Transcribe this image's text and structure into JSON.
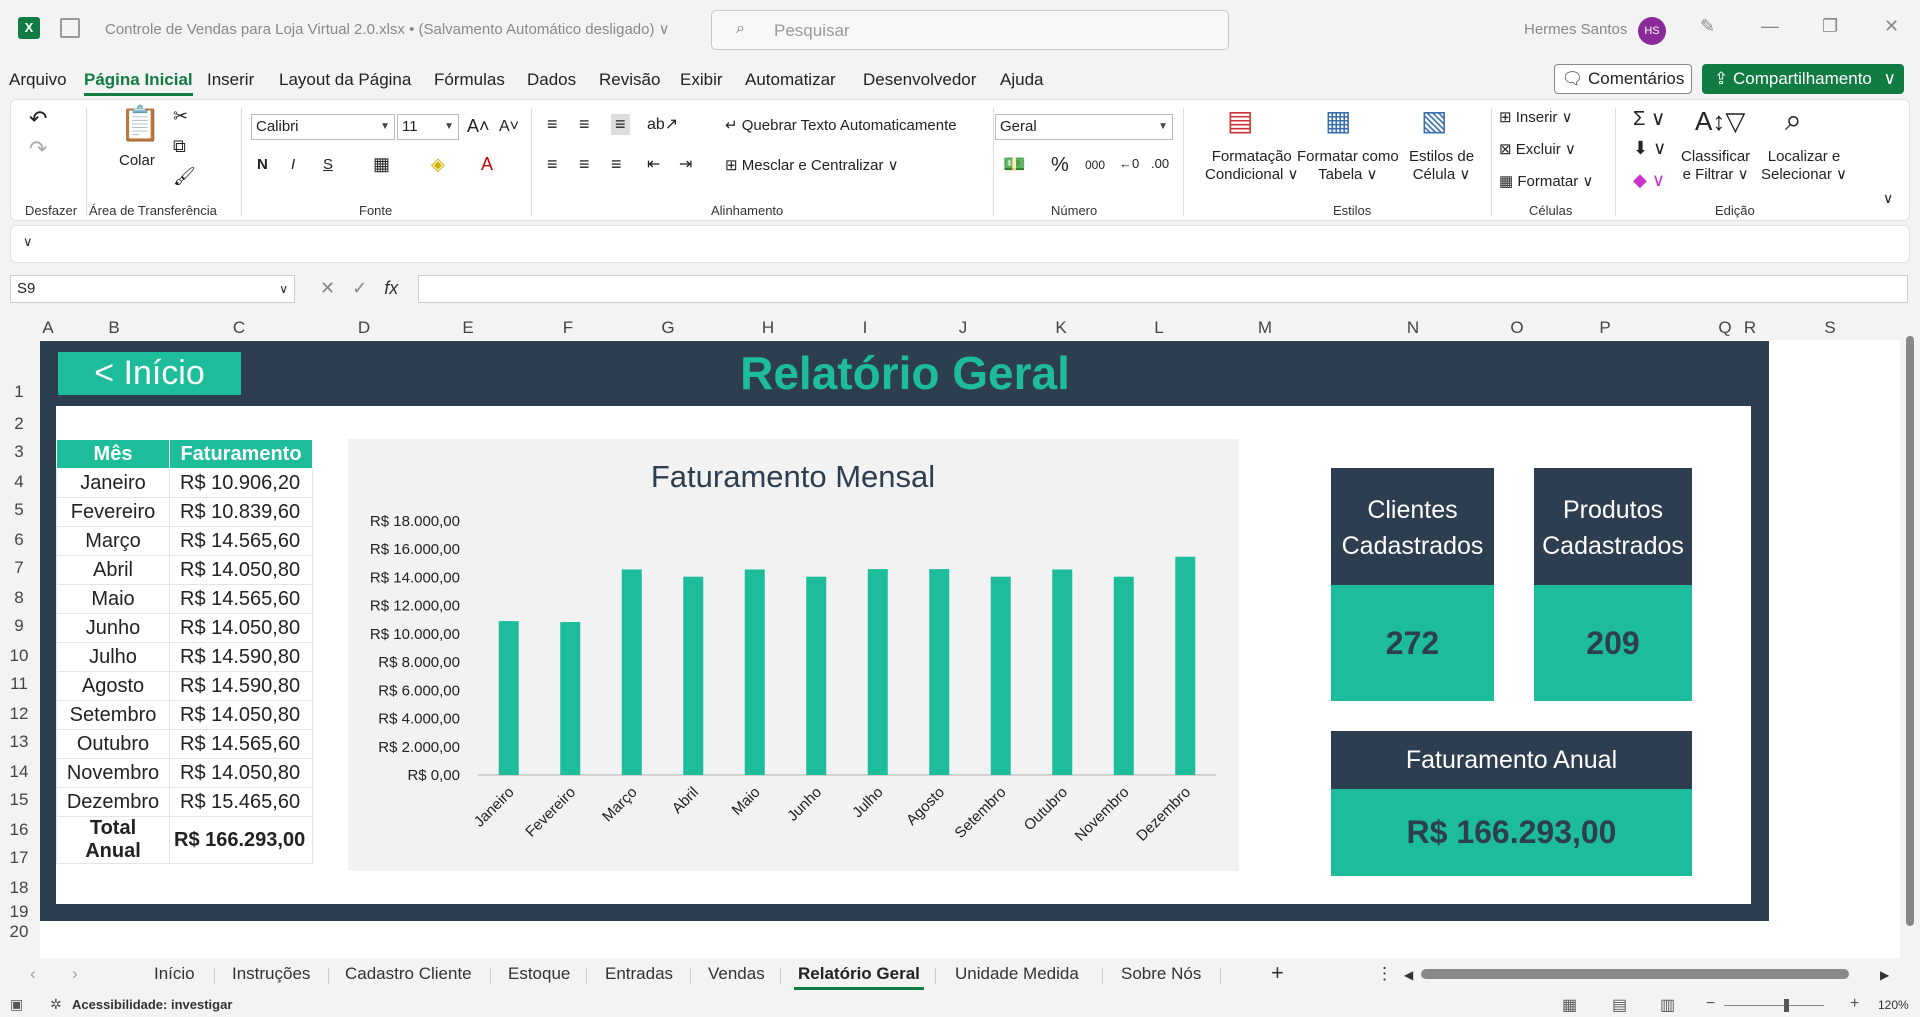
{
  "titlebar": {
    "doc_title": "Controle de Vendas para Loja Virtual 2.0.xlsx  •  (Salvamento Automático desligado) ∨",
    "search_placeholder": "Pesquisar",
    "user_name": "Hermes Santos",
    "user_initials": "HS"
  },
  "menu": {
    "items": [
      "Arquivo",
      "Página Inicial",
      "Inserir",
      "Layout da Página",
      "Fórmulas",
      "Dados",
      "Revisão",
      "Exibir",
      "Automatizar",
      "Desenvolvedor",
      "Ajuda"
    ],
    "active_index": 1,
    "comments_label": "Comentários",
    "share_label": "Compartilhamento"
  },
  "ribbon": {
    "groups": {
      "undo": "Desfazer",
      "clipboard": "Área de Transferência",
      "font": "Fonte",
      "alignment": "Alinhamento",
      "number": "Número",
      "styles": "Estilos",
      "cells": "Células",
      "editing": "Edição"
    },
    "paste_label": "Colar",
    "font_name": "Calibri",
    "font_size": "11",
    "bold": "N",
    "italic": "I",
    "underline": "S",
    "wrap_text": "Quebrar Texto Automaticamente",
    "merge_center": "Mesclar e Centralizar",
    "number_format": "Geral",
    "cond_format_1": "Formatação",
    "cond_format_2": "Condicional ∨",
    "format_table_1": "Formatar como",
    "format_table_2": "Tabela ∨",
    "cell_styles_1": "Estilos de",
    "cell_styles_2": "Célula ∨",
    "insert": "Inserir",
    "delete": "Excluir",
    "format": "Formatar",
    "sort_filter_1": "Classificar",
    "sort_filter_2": "e Filtrar ∨",
    "find_select_1": "Localizar e",
    "find_select_2": "Selecionar ∨"
  },
  "formula_bar": {
    "name_box": "S9",
    "fx": "fx",
    "value": ""
  },
  "columns": [
    "A",
    "B",
    "C",
    "D",
    "E",
    "F",
    "G",
    "H",
    "I",
    "J",
    "K",
    "L",
    "M",
    "N",
    "O",
    "P",
    "Q",
    "R",
    "S"
  ],
  "rows": [
    "1",
    "2",
    "3",
    "4",
    "5",
    "6",
    "7",
    "8",
    "9",
    "10",
    "11",
    "12",
    "13",
    "14",
    "15",
    "16",
    "17",
    "18",
    "19",
    "20"
  ],
  "dashboard": {
    "back_button": "< Início",
    "title": "Relatório Geral",
    "table": {
      "header_month": "Mês",
      "header_revenue": "Faturamento",
      "rows": [
        {
          "month": "Janeiro",
          "value": "R$ 10.906,20"
        },
        {
          "month": "Fevereiro",
          "value": "R$ 10.839,60"
        },
        {
          "month": "Março",
          "value": "R$ 14.565,60"
        },
        {
          "month": "Abril",
          "value": "R$ 14.050,80"
        },
        {
          "month": "Maio",
          "value": "R$ 14.565,60"
        },
        {
          "month": "Junho",
          "value": "R$ 14.050,80"
        },
        {
          "month": "Julho",
          "value": "R$ 14.590,80"
        },
        {
          "month": "Agosto",
          "value": "R$ 14.590,80"
        },
        {
          "month": "Setembro",
          "value": "R$ 14.050,80"
        },
        {
          "month": "Outubro",
          "value": "R$ 14.565,60"
        },
        {
          "month": "Novembro",
          "value": "R$ 14.050,80"
        },
        {
          "month": "Dezembro",
          "value": "R$ 15.465,60"
        }
      ],
      "total_label": "Total Anual",
      "total_value": "R$ 166.293,00"
    },
    "cards": {
      "clients_label_1": "Clientes",
      "clients_label_2": "Cadastrados",
      "clients_value": "272",
      "products_label_1": "Produtos",
      "products_label_2": "Cadastrados",
      "products_value": "209",
      "annual_label": "Faturamento Anual",
      "annual_value": "R$ 166.293,00"
    }
  },
  "chart_data": {
    "type": "bar",
    "title": "Faturamento Mensal",
    "xlabel": "",
    "ylabel": "",
    "categories": [
      "Janeiro",
      "Fevereiro",
      "Março",
      "Abril",
      "Maio",
      "Junho",
      "Julho",
      "Agosto",
      "Setembro",
      "Outubro",
      "Novembro",
      "Dezembro"
    ],
    "values": [
      10906.2,
      10839.6,
      14565.6,
      14050.8,
      14565.6,
      14050.8,
      14590.8,
      14590.8,
      14050.8,
      14565.6,
      14050.8,
      15465.6
    ],
    "ylim": [
      0,
      18000
    ],
    "yticks": [
      "R$ 0,00",
      "R$ 2.000,00",
      "R$ 4.000,00",
      "R$ 6.000,00",
      "R$ 8.000,00",
      "R$ 10.000,00",
      "R$ 12.000,00",
      "R$ 14.000,00",
      "R$ 16.000,00",
      "R$ 18.000,00"
    ],
    "grid": false,
    "legend": "none",
    "bar_color": "#1dbc9a"
  },
  "sheet_tabs": {
    "items": [
      "Início",
      "Instruções",
      "Cadastro Cliente",
      "Estoque",
      "Entradas",
      "Vendas",
      "Relatório Geral",
      "Unidade Medida",
      "Sobre Nós"
    ],
    "active_index": 6
  },
  "status": {
    "accessibility": "Acessibilidade: investigar",
    "zoom": "120%"
  },
  "colors": {
    "dark": "#2d3e50",
    "accent": "#1dbc9a",
    "excel_green": "#107c41"
  }
}
